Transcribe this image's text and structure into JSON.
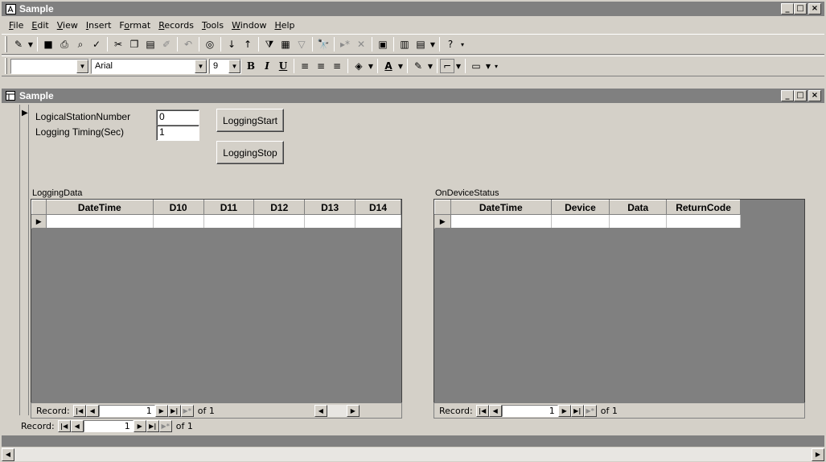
{
  "app": {
    "title": "Sample",
    "menu": [
      "File",
      "Edit",
      "View",
      "Insert",
      "Format",
      "Records",
      "Tools",
      "Window",
      "Help"
    ],
    "menu_mnemonics": [
      "F",
      "E",
      "V",
      "I",
      "o",
      "R",
      "T",
      "W",
      "H"
    ]
  },
  "format_toolbar": {
    "object_combo": "",
    "font": "Arial",
    "size": "9"
  },
  "form": {
    "title": "Sample",
    "fields": [
      {
        "label": "LogicalStationNumber",
        "value": "0"
      },
      {
        "label": "Logging Timing(Sec)",
        "value": "1"
      }
    ],
    "buttons": {
      "start": "LoggingStart",
      "stop": "LoggingStop"
    },
    "record_nav": {
      "label": "Record:",
      "current": "1",
      "of_text": "of 1"
    }
  },
  "logging_data": {
    "caption": "LoggingData",
    "columns": [
      "DateTime",
      "D10",
      "D11",
      "D12",
      "D13",
      "D14"
    ],
    "record_nav": {
      "label": "Record:",
      "current": "1",
      "of_text": "of 1"
    }
  },
  "device_status": {
    "caption": "OnDeviceStatus",
    "columns": [
      "DateTime",
      "Device",
      "Data",
      "ReturnCode"
    ],
    "record_nav": {
      "label": "Record:",
      "current": "1",
      "of_text": "of 1"
    }
  },
  "colors": {
    "titlebar": "#808080",
    "face": "#d4d0c8",
    "subform_bg": "#808080"
  }
}
